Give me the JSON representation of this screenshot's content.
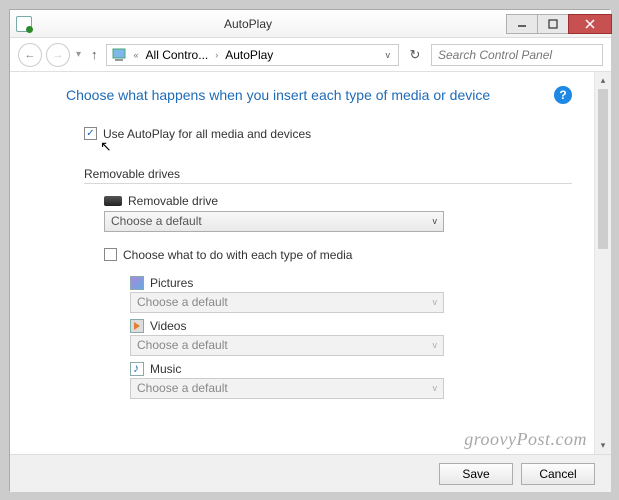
{
  "window": {
    "title": "AutoPlay"
  },
  "nav": {
    "crumb1": "All Contro...",
    "crumb2": "AutoPlay",
    "search_placeholder": "Search Control Panel"
  },
  "page": {
    "heading": "Choose what happens when you insert each type of media or device",
    "help_glyph": "?",
    "use_autoplay_label": "Use AutoPlay for all media and devices",
    "use_autoplay_checked": true,
    "section_removable": "Removable drives",
    "removable_drive_label": "Removable drive",
    "removable_drive_value": "Choose a default",
    "subtype_check_label": "Choose what to do with each type of media",
    "subtype_checked": false,
    "media": [
      {
        "label": "Pictures",
        "value": "Choose a default",
        "icon": "pic"
      },
      {
        "label": "Videos",
        "value": "Choose a default",
        "icon": "vid"
      },
      {
        "label": "Music",
        "value": "Choose a default",
        "icon": "mus"
      }
    ]
  },
  "footer": {
    "save": "Save",
    "cancel": "Cancel"
  },
  "watermark": "groovyPost.com"
}
